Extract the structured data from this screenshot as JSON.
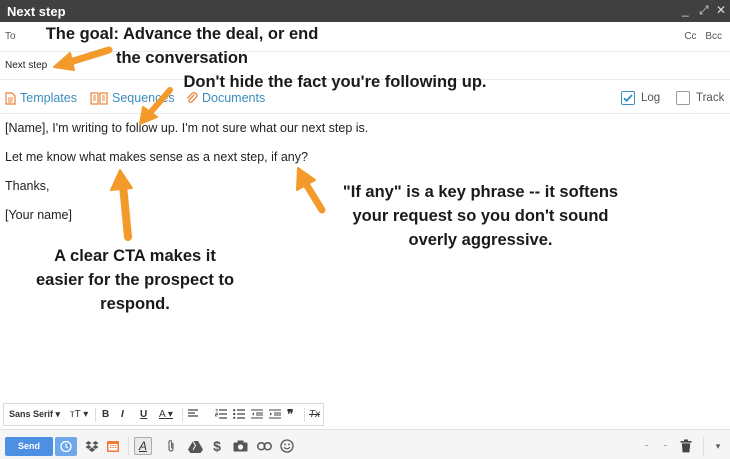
{
  "window": {
    "title": "Next step",
    "minimize": "_",
    "maximize": "⤢",
    "close": "✕"
  },
  "recipients": {
    "to_label": "To",
    "cc_label": "Cc",
    "bcc_label": "Bcc"
  },
  "subject": "Next step",
  "tools": {
    "templates": "Templates",
    "sequences": "Sequences",
    "documents": "Documents",
    "log_label": "Log",
    "log_checked": true,
    "track_label": "Track",
    "track_checked": false
  },
  "body": {
    "line1": "[Name], I'm writing to follow up. I'm not sure what our next step is.",
    "line2": "Let me know what makes sense as a next step, if any?",
    "line3": "Thanks,",
    "line4": "[Your name]"
  },
  "annotations": {
    "goal_1": "The goal: Advance the deal, or end",
    "goal_2": "the conversation",
    "followup": "Don't hide the fact you're following up.",
    "ifany_1": "\"If any\" is a key phrase -- it softens",
    "ifany_2": "your request so you don't sound",
    "ifany_3": "overly aggressive.",
    "cta_1": "A clear CTA makes it",
    "cta_2": "easier for the prospect to",
    "cta_3": "respond."
  },
  "accent": "#f39a2b",
  "link_color": "#3a8dbf",
  "format_bar": {
    "font": "Sans Serif",
    "size_icon": "тT",
    "bold": "B",
    "italic": "I",
    "underline": "U",
    "color": "A",
    "quote": "❞",
    "clear": "Tx"
  },
  "bottom": {
    "send": "Send",
    "dollar": "$"
  }
}
